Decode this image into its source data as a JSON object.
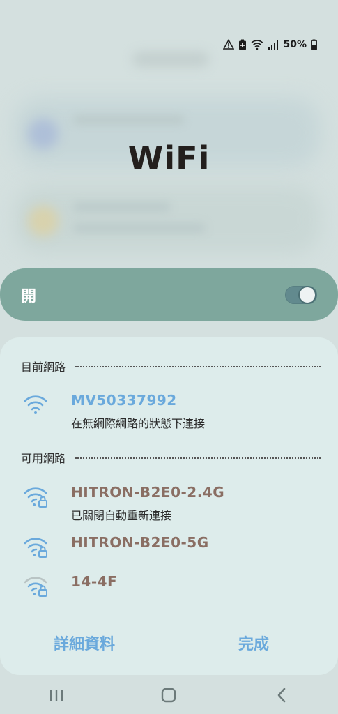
{
  "status_bar": {
    "battery_percent": "50%",
    "icons": [
      "warning-icon",
      "battery-saver-icon",
      "wifi-question-icon",
      "cell-signal-icon",
      "battery-icon"
    ]
  },
  "title": "WiFi",
  "wifi_toggle": {
    "label": "開",
    "state": "on"
  },
  "current_network": {
    "section_label": "目前網路",
    "name": "MV50337992",
    "status": "在無網際網路的狀態下連接"
  },
  "available_networks": {
    "section_label": "可用網路",
    "items": [
      {
        "name": "HITRON-B2E0-2.4G",
        "status": "已關閉自動重新連接",
        "icon": "wifi-lock-icon"
      },
      {
        "name": "HITRON-B2E0-5G",
        "status": "",
        "icon": "wifi-lock-icon"
      },
      {
        "name": "14-4F",
        "status": "",
        "icon": "wifi-lock-weak-icon"
      }
    ]
  },
  "footer": {
    "details_label": "詳細資料",
    "done_label": "完成"
  },
  "colors": {
    "accent": "#6aa9dc",
    "toggle_bg": "#7ea79d",
    "network_name": "#8a6e63",
    "panel_bg": "#ddeceb"
  },
  "nav_bar": {
    "icons": [
      "recent-apps-icon",
      "home-icon",
      "back-icon"
    ]
  }
}
